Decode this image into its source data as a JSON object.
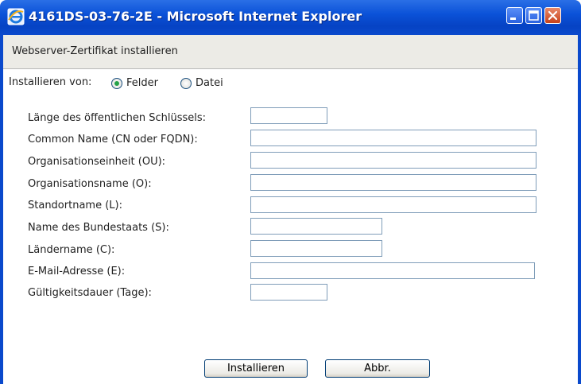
{
  "window": {
    "title": "4161DS-03-76-2E - Microsoft Internet Explorer"
  },
  "page": {
    "header": "Webserver-Zertifikat installieren",
    "install_from": {
      "label": "Installieren von:",
      "options": [
        {
          "label": "Felder",
          "selected": true
        },
        {
          "label": "Datei",
          "selected": false
        }
      ]
    },
    "fields": [
      {
        "label": "Länge des öffentlichen Schlüssels:",
        "value": ""
      },
      {
        "label": "Common Name (CN oder FQDN):",
        "value": ""
      },
      {
        "label": "Organisationseinheit (OU):",
        "value": ""
      },
      {
        "label": "Organisationsname (O):",
        "value": ""
      },
      {
        "label": "Standortname (L):",
        "value": ""
      },
      {
        "label": "Name des Bundestaats (S):",
        "value": ""
      },
      {
        "label": "Ländername (C):",
        "value": ""
      },
      {
        "label": "E-Mail-Adresse (E):",
        "value": ""
      },
      {
        "label": "Gültigkeitsdauer (Tage):",
        "value": ""
      }
    ],
    "buttons": {
      "install": "Installieren",
      "cancel": "Abbr."
    }
  },
  "icons": {
    "app": "internet-explorer-icon",
    "minimize": "minimize-icon",
    "maximize": "maximize-icon",
    "close": "close-icon"
  },
  "colors": {
    "titlebar": "#0b52d8",
    "radio_selected": "#24a148",
    "close_button": "#c8411a"
  }
}
